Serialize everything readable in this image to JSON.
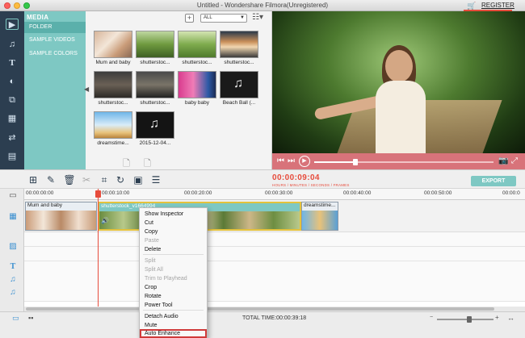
{
  "window": {
    "title": "Untitled - Wondershare Filmora(Unregistered)",
    "register_label": "REGISTER"
  },
  "sidebar_icons": [
    "media-icon",
    "music-icon",
    "text-icon",
    "filters-icon",
    "overlays-icon",
    "elements-icon",
    "transitions-icon",
    "split-screen-icon"
  ],
  "media_nav": {
    "title": "MEDIA",
    "items": [
      "FOLDER",
      "SAMPLE VIDEOS",
      "SAMPLE COLORS"
    ],
    "active_index": 0
  },
  "media_toolbar": {
    "add_label": "+",
    "filter_value": "ALL"
  },
  "media_items": [
    {
      "label": "Mum and baby",
      "kind": "video"
    },
    {
      "label": "shutterstoc...",
      "kind": "video"
    },
    {
      "label": "shutterstoc...",
      "kind": "video"
    },
    {
      "label": "shutterstoc...",
      "kind": "video"
    },
    {
      "label": "shutterstoc...",
      "kind": "video"
    },
    {
      "label": "shutterstoc...",
      "kind": "video"
    },
    {
      "label": "baby baby",
      "kind": "video"
    },
    {
      "label": "Beach Ball (...",
      "kind": "audio"
    },
    {
      "label": "dreamstime...",
      "kind": "video"
    },
    {
      "label": "2015-12-04...",
      "kind": "audio"
    }
  ],
  "preview": {
    "progress": 0.23
  },
  "timeline_toolbar": {
    "timecode": "00:00:09:04",
    "timecode_units": "HOURS / MINUTES / SECONDS / FRAMES",
    "export_label": "EXPORT"
  },
  "ruler": {
    "ticks": [
      "00:00:00:00",
      "00:00:10:00",
      "00:00:20:00",
      "00:00:30:00",
      "00:00:40:00",
      "00:00:50:00",
      "00:00:0"
    ]
  },
  "clips": [
    {
      "title": "Mum and baby",
      "selected": false
    },
    {
      "title": "shutterstock_v1664994",
      "selected": true
    },
    {
      "title": "dreamstime...",
      "selected": false
    }
  ],
  "context_menu": {
    "items": [
      {
        "label": "Show Inspector",
        "enabled": true
      },
      {
        "label": "Cut",
        "enabled": true
      },
      {
        "label": "Copy",
        "enabled": true
      },
      {
        "label": "Paste",
        "enabled": false
      },
      {
        "label": "Delete",
        "enabled": true
      },
      {
        "label": "Split",
        "enabled": false
      },
      {
        "label": "Split All",
        "enabled": false
      },
      {
        "label": "Trim to Playhead",
        "enabled": false
      },
      {
        "label": "Crop",
        "enabled": true
      },
      {
        "label": "Rotate",
        "enabled": true
      },
      {
        "label": "Power Tool",
        "enabled": true
      },
      {
        "label": "Detach Audio",
        "enabled": true
      },
      {
        "label": "Mute",
        "enabled": true
      },
      {
        "label": "Auto Enhance",
        "enabled": true,
        "highlighted": true
      }
    ]
  },
  "status": {
    "total_time": "TOTAL TIME:00:00:39:18",
    "zoom_level": 0.57
  }
}
